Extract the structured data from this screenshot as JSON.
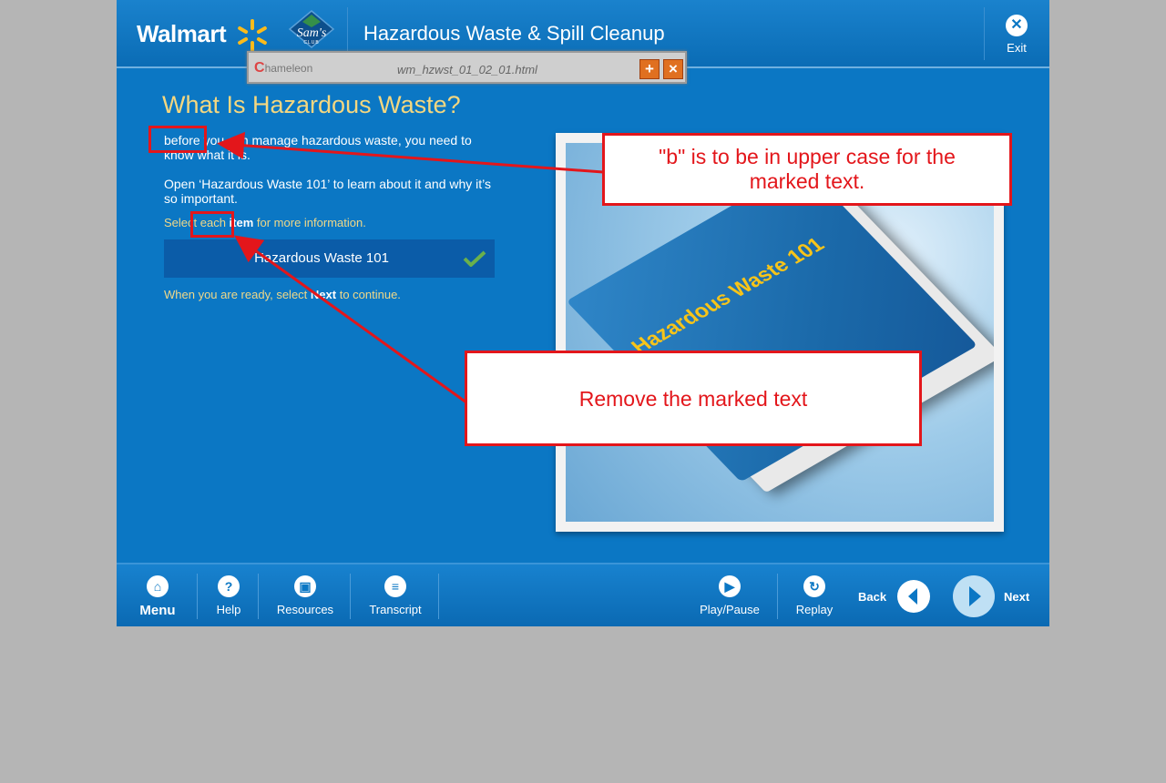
{
  "header": {
    "brand": "Walmart",
    "sams_logo": "Sam's",
    "sams_sub": "CLUB",
    "course_title": "Hazardous Waste & Spill Cleanup",
    "exit_label": "Exit"
  },
  "chameleon_bar": {
    "logo_text": "hameleon",
    "logo_initial": "C",
    "filename": "wm_hzwst_01_02_01.html"
  },
  "content": {
    "page_title": "What Is Hazardous Waste?",
    "para1": "before you can manage hazardous waste, you need to know what it is.",
    "para2": "Open ‘Hazardous Waste 101’ to learn about it and why it’s so important.",
    "instr_pre": "Select each ",
    "instr_bold": "item",
    "instr_post": " for more information.",
    "topic_button": "Hazardous Waste 101",
    "topic_completed": true,
    "continue_pre": "When you are ready, select ",
    "continue_bold": "Next",
    "continue_post": " to continue.",
    "image_book_title": "Hazardous Waste 101"
  },
  "footer": {
    "menu": "Menu",
    "help": "Help",
    "resources": "Resources",
    "transcript": "Transcript",
    "play_pause": "Play/Pause",
    "replay": "Replay",
    "back": "Back",
    "next": "Next"
  },
  "annotations": {
    "callout1": "\"b\" is to be in upper case for the marked text.",
    "callout2": "Remove the marked text"
  },
  "colors": {
    "course_blue": "#0b77c4",
    "title_gold": "#f4d780",
    "annotation_red": "#e3161b",
    "check_green": "#6ab04c",
    "book_title_yellow": "#f7c419"
  }
}
